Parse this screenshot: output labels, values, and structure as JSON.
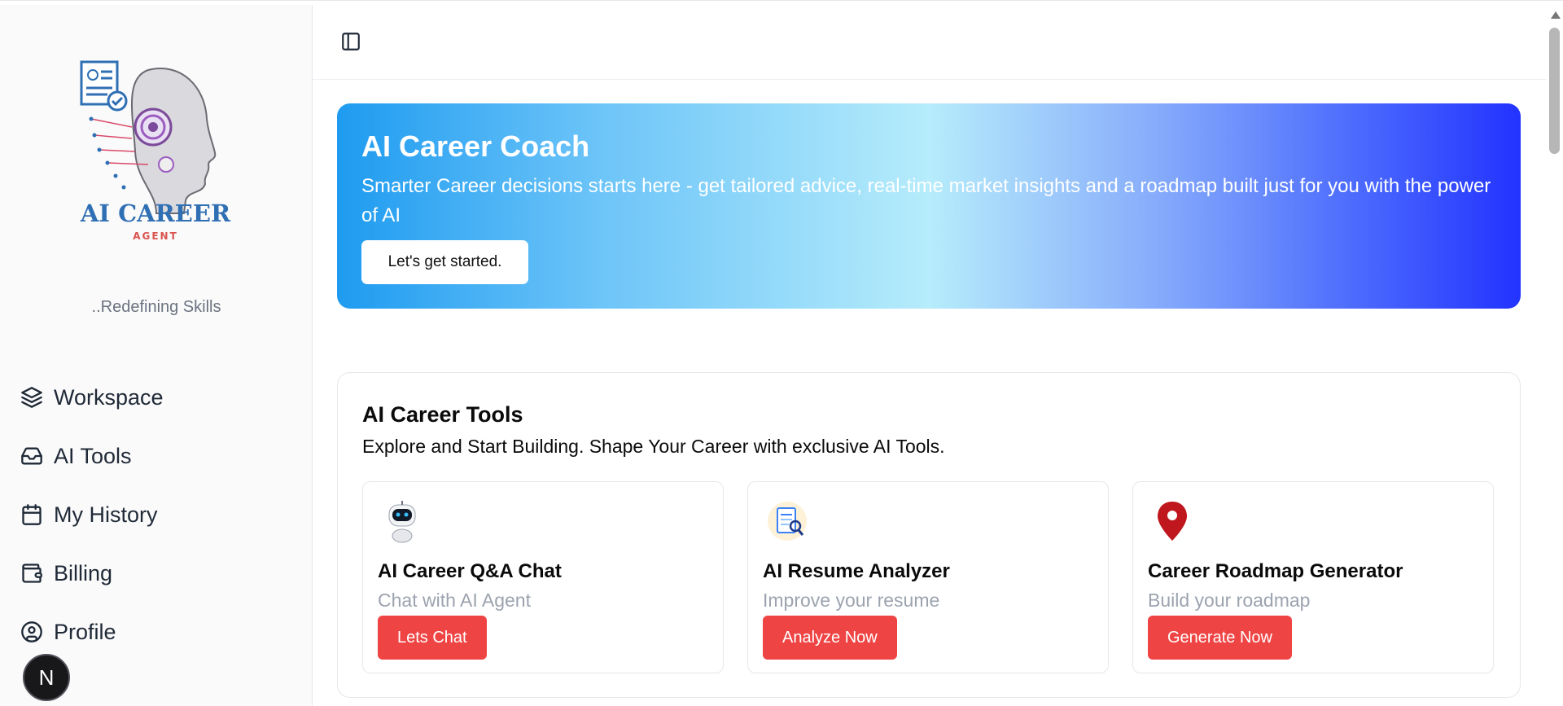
{
  "sidebar": {
    "logo": {
      "line1": "AI CAREER",
      "line2": "AGENT"
    },
    "tagline": "..Redefining Skills",
    "items": [
      {
        "label": "Workspace",
        "icon": "layers-icon"
      },
      {
        "label": "AI Tools",
        "icon": "inbox-icon"
      },
      {
        "label": "My History",
        "icon": "calendar-icon"
      },
      {
        "label": "Billing",
        "icon": "wallet-icon"
      },
      {
        "label": "Profile",
        "icon": "user-circle-icon"
      }
    ],
    "badge": "N"
  },
  "topbar": {
    "toggle_icon": "sidebar-toggle-icon"
  },
  "hero": {
    "title": "AI Career Coach",
    "subtitle": "Smarter Career decisions starts here - get tailored advice, real-time market insights and a roadmap built just for you with the power of AI",
    "button": "Let's get started."
  },
  "tools": {
    "title": "AI Career Tools",
    "subtitle": "Explore and Start Building. Shape Your Career with exclusive AI Tools.",
    "cards": [
      {
        "title": "AI Career Q&A Chat",
        "desc": "Chat with AI Agent",
        "button": "Lets Chat",
        "icon": "robot-icon"
      },
      {
        "title": "AI Resume Analyzer",
        "desc": "Improve your resume",
        "button": "Analyze Now",
        "icon": "resume-icon"
      },
      {
        "title": "Career Roadmap Generator",
        "desc": "Build your roadmap",
        "button": "Generate Now",
        "icon": "map-pin-icon"
      }
    ]
  },
  "colors": {
    "accent_red": "#ef4444",
    "hero_start": "#1e9bf0",
    "hero_end": "#2233ff"
  }
}
